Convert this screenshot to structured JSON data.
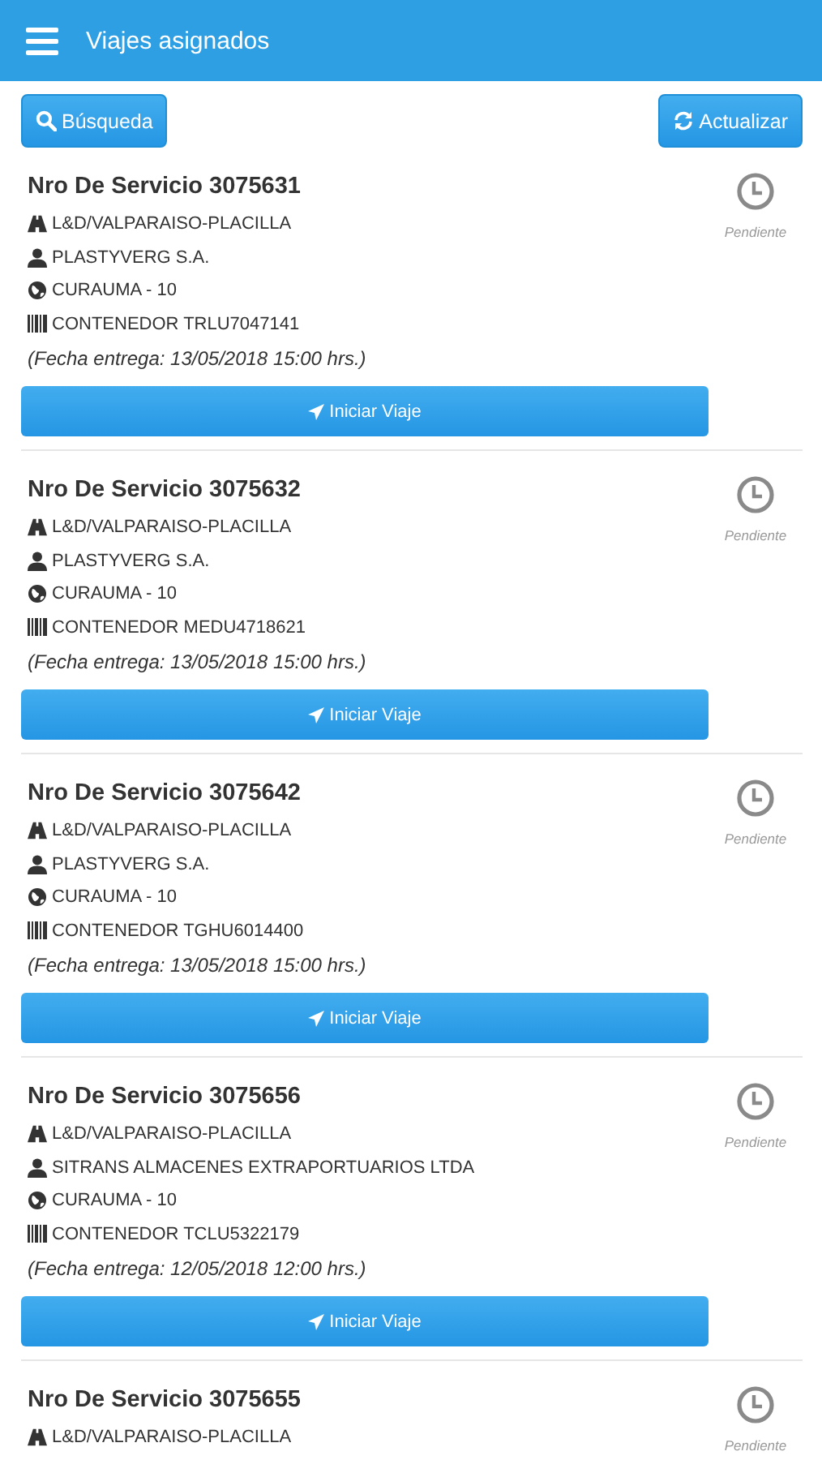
{
  "header": {
    "title": "Viajes asignados"
  },
  "toolbar": {
    "search_button": "Búsqueda",
    "refresh_button": "Actualizar"
  },
  "services": [
    {
      "title": "Nro De Servicio 3075631",
      "status": "Pendiente",
      "lines": [
        {
          "kind": "route",
          "text": "L&D/VALPARAISO-PLACILLA"
        },
        {
          "kind": "client",
          "text": "PLASTYVERG S.A."
        },
        {
          "kind": "place",
          "text": "CURAUMA - 10"
        },
        {
          "kind": "container",
          "text": "CONTENEDOR TRLU7047141"
        }
      ],
      "delivery": "(Fecha entrega: 13/05/2018 15:00 hrs.)",
      "action": "Iniciar Viaje"
    },
    {
      "title": "Nro De Servicio 3075632",
      "status": "Pendiente",
      "lines": [
        {
          "kind": "route",
          "text": "L&D/VALPARAISO-PLACILLA"
        },
        {
          "kind": "client",
          "text": "PLASTYVERG S.A."
        },
        {
          "kind": "place",
          "text": "CURAUMA - 10"
        },
        {
          "kind": "container",
          "text": "CONTENEDOR MEDU4718621"
        }
      ],
      "delivery": "(Fecha entrega: 13/05/2018 15:00 hrs.)",
      "action": "Iniciar Viaje"
    },
    {
      "title": "Nro De Servicio 3075642",
      "status": "Pendiente",
      "lines": [
        {
          "kind": "route",
          "text": "L&D/VALPARAISO-PLACILLA"
        },
        {
          "kind": "client",
          "text": "PLASTYVERG S.A."
        },
        {
          "kind": "place",
          "text": "CURAUMA - 10"
        },
        {
          "kind": "container",
          "text": "CONTENEDOR TGHU6014400"
        }
      ],
      "delivery": "(Fecha entrega: 13/05/2018 15:00 hrs.)",
      "action": "Iniciar Viaje"
    },
    {
      "title": "Nro De Servicio 3075656",
      "status": "Pendiente",
      "lines": [
        {
          "kind": "route",
          "text": "L&D/VALPARAISO-PLACILLA"
        },
        {
          "kind": "client",
          "text": "SITRANS ALMACENES EXTRAPORTUARIOS LTDA"
        },
        {
          "kind": "place",
          "text": "CURAUMA - 10"
        },
        {
          "kind": "container",
          "text": "CONTENEDOR TCLU5322179"
        }
      ],
      "delivery": "(Fecha entrega: 12/05/2018 12:00 hrs.)",
      "action": "Iniciar Viaje"
    },
    {
      "title": "Nro De Servicio 3075655",
      "status": "Pendiente",
      "lines": [
        {
          "kind": "route",
          "text": "L&D/VALPARAISO-PLACILLA"
        }
      ]
    }
  ]
}
